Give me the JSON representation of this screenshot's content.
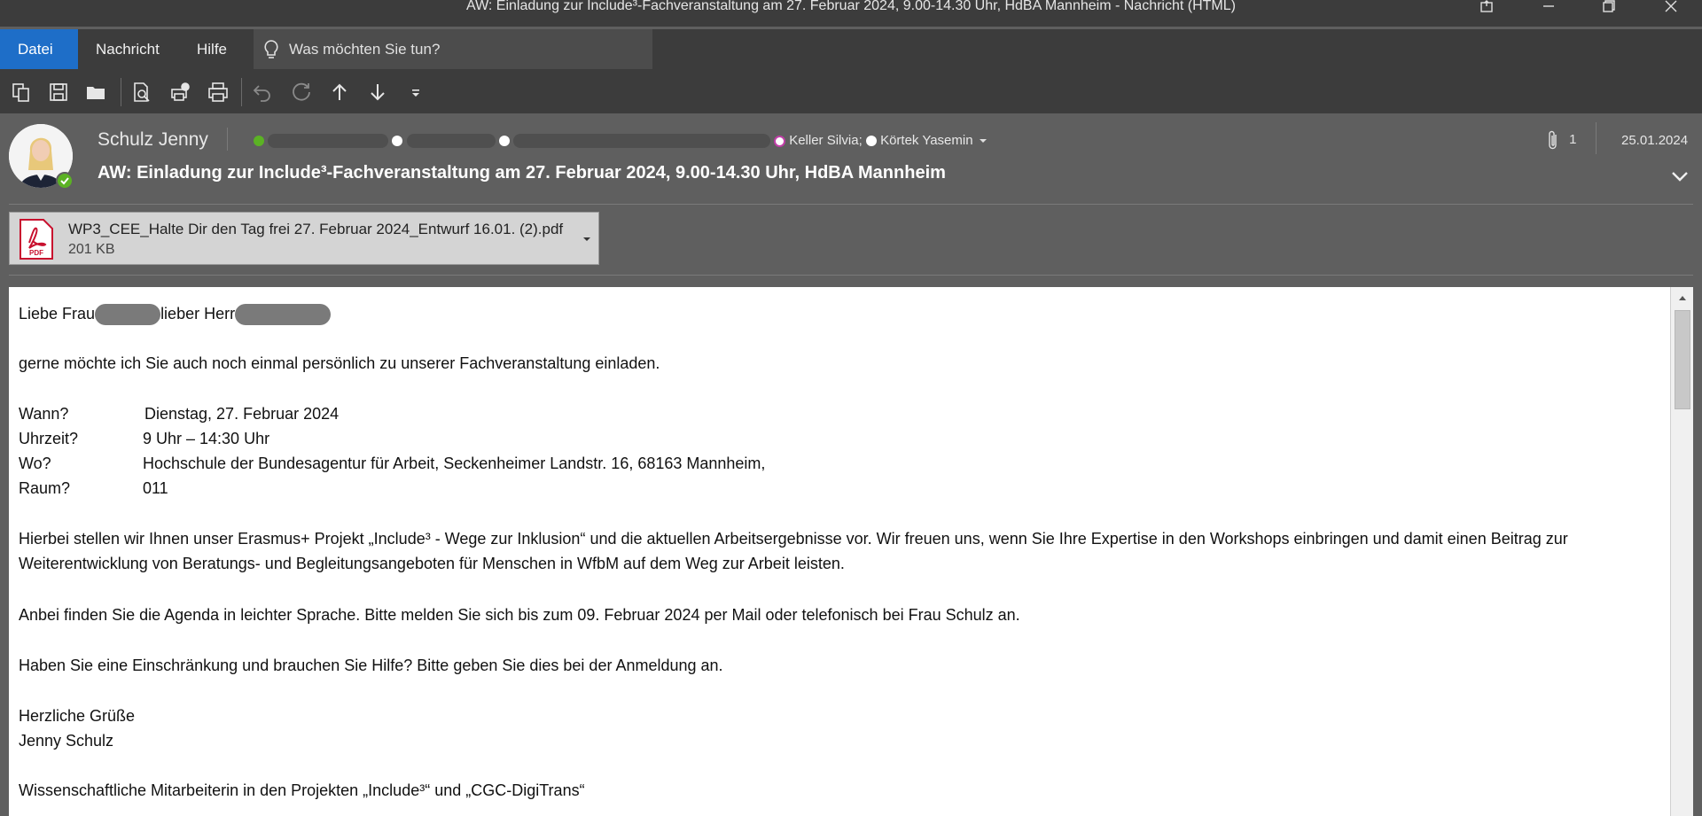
{
  "window": {
    "title": "AW: Einladung zur Include³-Fachveranstaltung am 27. Februar 2024, 9.00-14.30 Uhr, HdBA Mannheim  -  Nachricht (HTML)"
  },
  "menu": {
    "file": "Datei",
    "message": "Nachricht",
    "help": "Hilfe",
    "tellme_placeholder": "Was möchten Sie tun?"
  },
  "header": {
    "sender": "Schulz Jenny",
    "recipients_named": [
      "Keller Silvia;",
      "Körtek Yasemin"
    ],
    "subject": "AW: Einladung zur Include³-Fachveranstaltung am 27. Februar 2024, 9.00-14.30 Uhr, HdBA Mannheim",
    "attachment_count": "1",
    "date": "25.01.2024"
  },
  "attachment": {
    "name": "WP3_CEE_Halte Dir den Tag frei 27. Februar 2024_Entwurf 16.01. (2).pdf",
    "size": "201 KB",
    "icon_label": "PDF"
  },
  "body": {
    "greeting_a": "Liebe Frau",
    "greeting_b": "lieber Herr",
    "intro": "gerne möchte ich Sie auch noch einmal persönlich zu unserer Fachveranstaltung einladen.",
    "details": [
      {
        "label": "Wann?",
        "value": "Dienstag, 27. Februar 2024"
      },
      {
        "label": "Uhrzeit?",
        "value": "9 Uhr – 14:30 Uhr"
      },
      {
        "label": "Wo?",
        "value": "Hochschule der Bundesagentur für Arbeit, Seckenheimer Landstr. 16, 68163 Mannheim,"
      },
      {
        "label": "Raum?",
        "value": "011"
      }
    ],
    "para1": "Hierbei stellen wir Ihnen unser Erasmus+ Projekt „Include³ - Wege zur Inklusion“ und die aktuellen Arbeitsergebnisse vor. Wir freuen uns, wenn Sie Ihre Expertise in den Workshops einbringen und damit einen Beitrag zur Weiterentwicklung von Beratungs- und Begleitungsangeboten für Menschen in WfbM auf dem Weg zur Arbeit leisten.",
    "para2": "Anbei finden Sie die Agenda in leichter Sprache. Bitte melden Sie sich bis zum 09. Februar 2024 per Mail oder telefonisch bei Frau Schulz an.",
    "para3": "Haben Sie eine Einschränkung und brauchen Sie Hilfe? Bitte geben Sie dies bei der Anmeldung an.",
    "closing": "Herzliche Grüße",
    "signature": "Jenny Schulz",
    "role": "Wissenschaftliche Mitarbeiterin in den Projekten „Include³“ und „CGC-DigiTrans“"
  }
}
